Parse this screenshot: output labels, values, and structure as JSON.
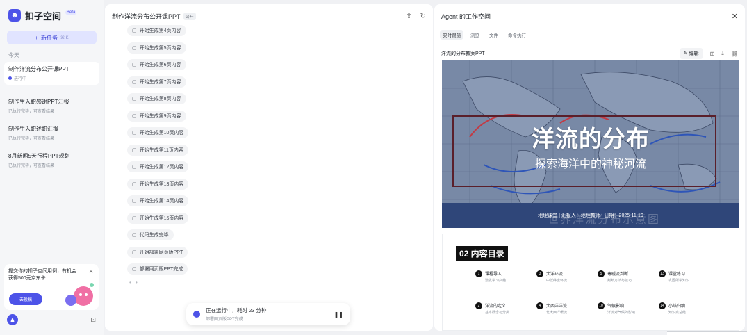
{
  "app": {
    "name": "扣子空间",
    "badge": "Beta"
  },
  "sidebar": {
    "new_task": "新任务",
    "new_task_shortcut": "⌘ K",
    "section_label": "今天",
    "tasks": [
      {
        "title": "制作洋流分布公开课PPT",
        "sub": "进行中"
      },
      {
        "title": "制作生入职感谢PPT汇报",
        "sub": "已执行完毕，可查看结果"
      },
      {
        "title": "制作生入职述职汇报",
        "sub": "已执行完毕，可查看结果"
      },
      {
        "title": "8月新闻5天行程PPT规划",
        "sub": "已执行完毕，可查看结果"
      }
    ],
    "promo": {
      "text": "提交你的扣子空间用例，有机会获得500元京东卡",
      "button": "去投稿"
    }
  },
  "chat": {
    "title": "制作洋流分布公开课PPT",
    "tag": "公开",
    "steps": [
      "开始生成第4页内容",
      "开始生成第5页内容",
      "开始生成第6页内容",
      "开始生成第7页内容",
      "开始生成第8页内容",
      "开始生成第9页内容",
      "开始生成第10页内容",
      "开始生成第11页内容",
      "开始生成第12页内容",
      "开始生成第13页内容",
      "开始生成第14页内容",
      "开始生成第15页内容",
      "代码生成完毕",
      "开始部署网页版PPT",
      "部署网页版PPT完成"
    ],
    "typing": "• •",
    "status": {
      "main": "正在运行中，耗时 23 分钟",
      "sub": "部署网页版PPT完成..."
    }
  },
  "workspace": {
    "title": "Agent 的工作空间",
    "tabs": [
      "实时跟随",
      "浏览",
      "文件",
      "命令执行"
    ],
    "file_name": "洋流的分布教案PPT",
    "edit_label": "编辑",
    "slide1": {
      "title": "洋流的分布",
      "subtitle": "探索海洋中的神秘河流",
      "footer": "地理课堂 | 汇报人：地理教师 | 日期：2025-11-10",
      "watermark": "世界洋流分布示意图"
    },
    "slide2": {
      "title": "02 内容目录",
      "items": [
        {
          "num": "1",
          "title": "课程导入",
          "desc": "激发学习兴趣"
        },
        {
          "num": "3",
          "title": "大洋环流",
          "desc": "中低纬度环流"
        },
        {
          "num": "5",
          "title": "寒暖流判断",
          "desc": "判断方法与技巧"
        },
        {
          "num": "13",
          "title": "课堂练习",
          "desc": "巩固所学知识"
        },
        {
          "num": "2",
          "title": "洋流的定义",
          "desc": "基本概念与分类"
        },
        {
          "num": "4",
          "title": "大西洋洋流",
          "desc": "北大西洋暖流"
        },
        {
          "num": "10",
          "title": "气候影响",
          "desc": "洋流对气候的影响"
        },
        {
          "num": "14",
          "title": "小结归纳",
          "desc": "知识点总结"
        }
      ]
    }
  },
  "colors": {
    "accent": "#4d53e8",
    "slide_bg": "#6a7b9a"
  }
}
